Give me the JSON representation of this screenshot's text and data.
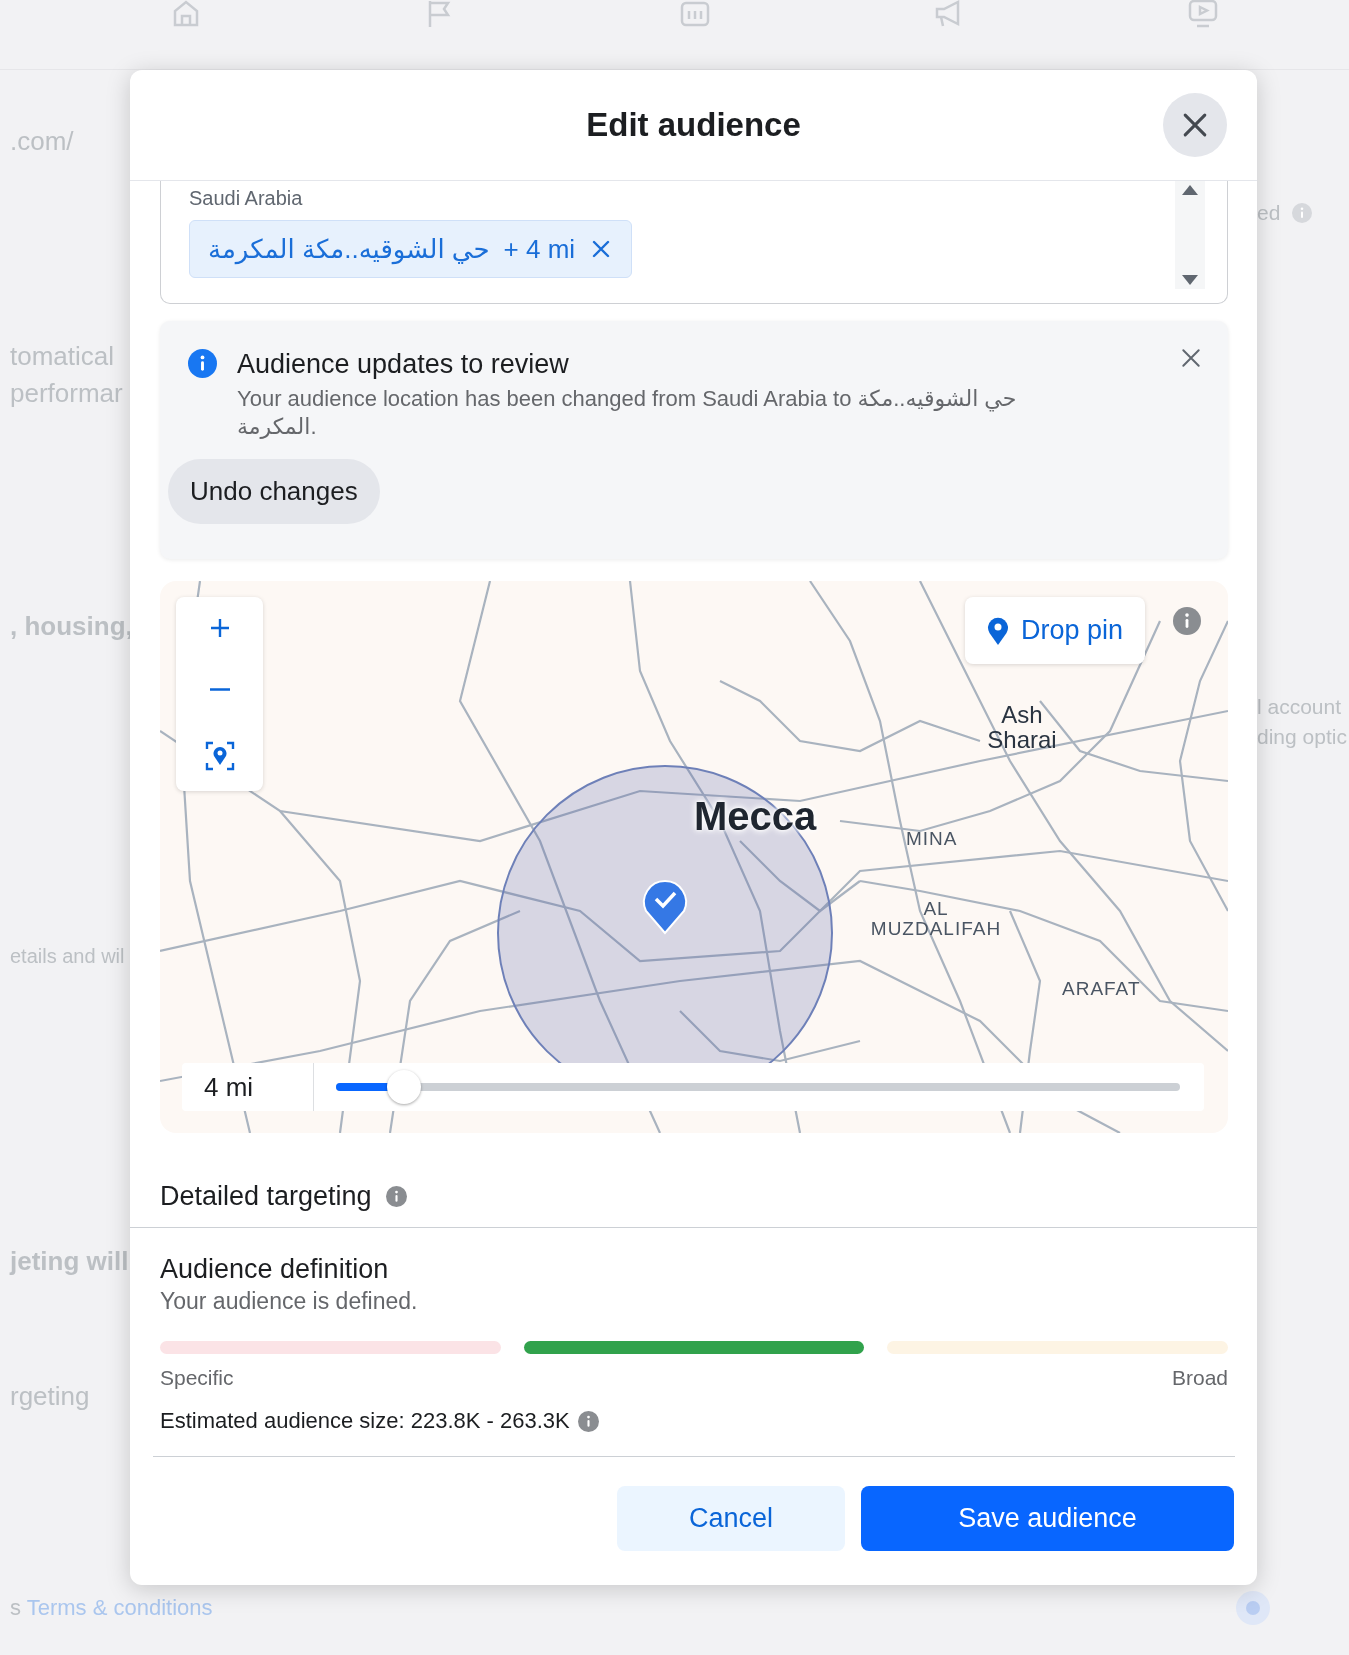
{
  "background_page": {
    "left_texts": [
      ".com/",
      "tomatical",
      "performar",
      ", housing,",
      "etails and wil",
      "jeting will",
      "rgeting"
    ],
    "right_texts": [
      "ed",
      "l account",
      "ding optic"
    ],
    "footer": {
      "prefix": "s",
      "link": "Terms & conditions"
    }
  },
  "dialog": {
    "title": "Edit audience",
    "location": {
      "country": "Saudi Arabia",
      "chip": {
        "place": "حي الشوقيه..مكة المكرمة",
        "radius": "+ 4 mi"
      }
    },
    "notice": {
      "title": "Audience updates to review",
      "message": "Your audience location has been changed from Saudi Arabia to حي الشوقيه..مكة المكرمة.",
      "action": "Undo changes"
    },
    "map": {
      "drop_pin": "Drop pin",
      "labels": [
        {
          "text": "Ash Sharai",
          "kind": "town"
        },
        {
          "text": "Mecca",
          "kind": "city"
        },
        {
          "text": "MINA",
          "kind": "district"
        },
        {
          "text": "AL MUZDALIFAH",
          "kind": "district"
        },
        {
          "text": "ARAFAT",
          "kind": "district"
        }
      ],
      "radius": {
        "reading": "4 mi",
        "level": 0.08
      }
    },
    "detailed_targeting": {
      "title": "Detailed targeting"
    },
    "audience_definition": {
      "title": "Audience definition",
      "status": "Your audience is defined.",
      "segments": [
        {
          "selected": false
        },
        {
          "selected": true
        },
        {
          "selected": false
        }
      ],
      "low_label": "Specific",
      "high_label": "Broad",
      "estimate": "Estimated audience size: 223.8K - 263.3K"
    },
    "buttons": [
      {
        "label": "Cancel",
        "kind": "secondary"
      },
      {
        "label": "Save audience",
        "kind": "primary"
      }
    ]
  }
}
